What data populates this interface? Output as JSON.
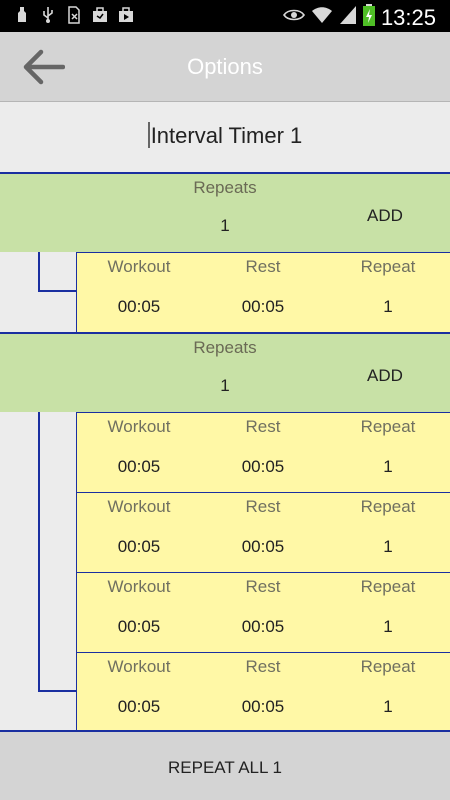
{
  "status": {
    "time": "13:25",
    "icons_left": [
      "notification-icon",
      "usb-icon",
      "no-sim-icon",
      "briefcase-icon",
      "media-icon"
    ],
    "icons_right": [
      "eye-icon",
      "wifi-icon",
      "signal-icon",
      "battery-icon"
    ]
  },
  "actionbar": {
    "title": "Options"
  },
  "timer": {
    "name": "Interval Timer 1"
  },
  "groups": [
    {
      "repeats_label": "Repeats",
      "repeats_value": "1",
      "add_label": "ADD",
      "intervals": [
        {
          "workout_label": "Workout",
          "rest_label": "Rest",
          "repeat_label": "Repeat",
          "workout": "00:05",
          "rest": "00:05",
          "repeat": "1"
        }
      ]
    },
    {
      "repeats_label": "Repeats",
      "repeats_value": "1",
      "add_label": "ADD",
      "intervals": [
        {
          "workout_label": "Workout",
          "rest_label": "Rest",
          "repeat_label": "Repeat",
          "workout": "00:05",
          "rest": "00:05",
          "repeat": "1"
        },
        {
          "workout_label": "Workout",
          "rest_label": "Rest",
          "repeat_label": "Repeat",
          "workout": "00:05",
          "rest": "00:05",
          "repeat": "1"
        },
        {
          "workout_label": "Workout",
          "rest_label": "Rest",
          "repeat_label": "Repeat",
          "workout": "00:05",
          "rest": "00:05",
          "repeat": "1"
        },
        {
          "workout_label": "Workout",
          "rest_label": "Rest",
          "repeat_label": "Repeat",
          "workout": "00:05",
          "rest": "00:05",
          "repeat": "1"
        }
      ]
    }
  ],
  "bottom": {
    "repeat_all_label": "REPEAT ALL 1"
  },
  "colors": {
    "group_header": "#c8e1a6",
    "interval_row": "#fff8a6",
    "tree_line": "#1a2fa0"
  }
}
